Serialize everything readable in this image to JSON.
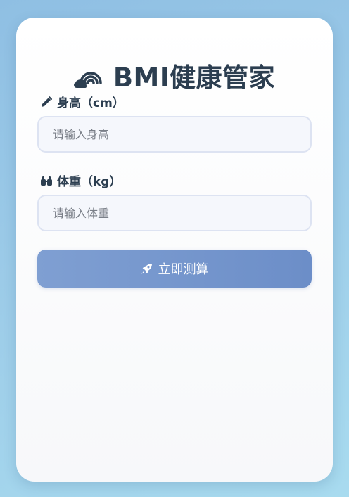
{
  "app": {
    "title": "BMI健康管家",
    "title_icon": "rainbow-cloud-icon"
  },
  "form": {
    "height": {
      "label": "身高（cm）",
      "icon": "ruler-pencil-icon",
      "placeholder": "请输入身高",
      "value": ""
    },
    "weight": {
      "label": "体重（kg）",
      "icon": "weight-icon",
      "placeholder": "请输入体重",
      "value": ""
    },
    "submit": {
      "label": "立即测算",
      "icon": "rocket-icon"
    }
  },
  "colors": {
    "primary_text": "#2c3e50",
    "button_start": "#7f9fd2",
    "button_end": "#6c8ec8",
    "input_bg": "#f5f7fc",
    "input_border": "#dde3f2"
  }
}
